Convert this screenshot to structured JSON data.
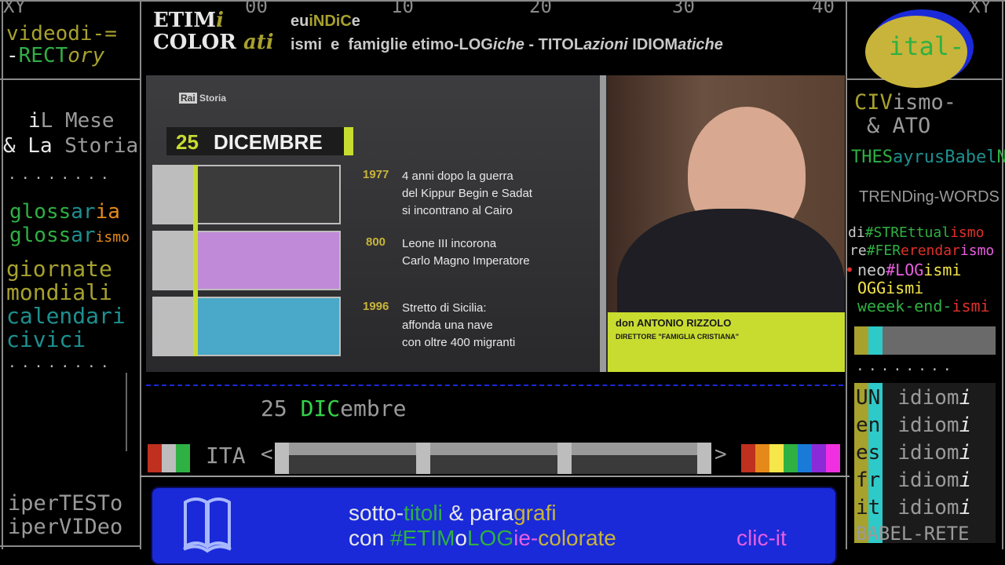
{
  "ruler": {
    "xy_left": "XY",
    "xy_right": "XY",
    "marks": [
      "00",
      "10",
      "20",
      "30",
      "40"
    ]
  },
  "logo": {
    "line1_a": "ETIM",
    "line1_b": "i",
    "line2_a": "COLOR",
    "line2_b": "ati"
  },
  "header": {
    "link1_a": "eu",
    "link1_b": "iNDiC",
    "link1_c": "e",
    "link2": [
      {
        "t": "ismi  e  famiglie etimo-LOG",
        "c": "#c9c9c9"
      },
      {
        "t": "iche",
        "c": "#c9c9c9",
        "i": true
      },
      {
        "t": " - TITOL",
        "c": "#c9c9c9"
      },
      {
        "t": "azioni",
        "c": "#c9c9c9",
        "i": true
      },
      {
        "t": " IDIOM",
        "c": "#c9c9c9"
      },
      {
        "t": "atiche",
        "c": "#c9c9c9",
        "i": true
      }
    ]
  },
  "left_nav": {
    "video_a": "videodi-=",
    "video_b": "RECT",
    "video_c": "ory",
    "mese_a": "i",
    "mese_b": "L Mese",
    "storia_a": "& La ",
    "storia_b": "Storia",
    "dots1": "........",
    "gloss1_a": "gloss",
    "gloss1_b": "ar",
    "gloss1_c": "ia",
    "gloss2_a": "gloss",
    "gloss2_b": "ar",
    "gloss2_c": "ismo",
    "giornate": "giornate",
    "mondiali": "mondiali",
    "calendari": "calendari",
    "civici": "civici",
    "dots2": "........",
    "ipertesto": "iperTESTo",
    "ipervideo": "iperVIDeo"
  },
  "badge": {
    "label": "ital-",
    "color": "#c8b43a",
    "ring": "#1a2ad8"
  },
  "right_nav": {
    "civ_a": "CIV",
    "civ_b": "ismo-",
    "ato_a": "&  ",
    "ato_b": "ATO",
    "thes": [
      {
        "t": "T",
        "c": "#2fb043"
      },
      {
        "t": "HES",
        "c": "#2fb043"
      },
      {
        "t": "ayrus",
        "c": "#1e8f8f"
      },
      {
        "t": "Babel",
        "c": "#1e8f8f"
      },
      {
        "t": "Net",
        "c": "#2fb043"
      }
    ],
    "trending": "TRENDing-WORDS",
    "hashtags": [
      {
        "parts": [
          {
            "t": "di",
            "c": "#c9c9c9"
          },
          {
            "t": "#STREttual",
            "c": "#2fb043"
          },
          {
            "t": "ismo",
            "c": "#e0302a"
          }
        ]
      },
      {
        "parts": [
          {
            "t": "re",
            "c": "#c9c9c9"
          },
          {
            "t": "#FER",
            "c": "#2fb043"
          },
          {
            "t": "erendar",
            "c": "#e0302a"
          },
          {
            "t": "ismo",
            "c": "#e85fe0"
          }
        ]
      },
      {
        "parts": [
          {
            "t": "neo",
            "c": "#c9c9c9"
          },
          {
            "t": "#LOG",
            "c": "#e85fe0"
          },
          {
            "t": "ismi",
            "c": "#f5e64a"
          }
        ]
      },
      {
        "parts": [
          {
            "t": "OGG",
            "c": "#f5e64a"
          },
          {
            "t": "ismi",
            "c": "#f5e64a"
          }
        ]
      },
      {
        "parts": [
          {
            "t": "weeek-end-",
            "c": "#2fb043"
          },
          {
            "t": "ismi",
            "c": "#e0302a"
          }
        ]
      }
    ],
    "idioms": [
      {
        "code": "UN",
        "word": "idiom",
        "suf": "i"
      },
      {
        "code": "en",
        "word": "idiom",
        "suf": "i"
      },
      {
        "code": "es",
        "word": "idiom",
        "suf": "i"
      },
      {
        "code": "fr",
        "word": "idiom",
        "suf": "i"
      },
      {
        "code": "it",
        "word": "idiom",
        "suf": "i"
      }
    ],
    "babel": "BABEL-RETE"
  },
  "video": {
    "channel": "Rai Storia",
    "date_day": "25",
    "date_month": "DICEMBRE",
    "events": [
      {
        "year": "1977",
        "text": "4 anni dopo la guerra\ndel Kippur Begin e Sadat\nsi incontrano al Cairo"
      },
      {
        "year": "800",
        "text": "Leone III incorona\nCarlo Magno Imperatore"
      },
      {
        "year": "1996",
        "text": "Stretto di Sicilia:\naffonda una nave\ncon oltre 400 migranti"
      }
    ],
    "guest_name": "don ANTONIO RIZZOLO",
    "guest_role": "DIRETTORE \"FAMIGLIA CRISTIANA\""
  },
  "caption": {
    "day": "25 ",
    "month_a": "DIC",
    "month_b": "embre"
  },
  "player": {
    "lang": "ITA",
    "prev": "<",
    "next": ">"
  },
  "subtitle_bar": {
    "line1": [
      {
        "t": "sotto-",
        "c": "#e8e8e8"
      },
      {
        "t": "titoli",
        "c": "#2fb043"
      },
      {
        "t": " & para",
        "c": "#e8e8e8"
      },
      {
        "t": "grafi",
        "c": "#c8b43a"
      }
    ],
    "line2": [
      {
        "t": "con ",
        "c": "#e8e8e8"
      },
      {
        "t": "#ETIM",
        "c": "#2fb043"
      },
      {
        "t": "o",
        "c": "#e8e8e8"
      },
      {
        "t": "LOG",
        "c": "#2fb043"
      },
      {
        "t": "ie-",
        "c": "#e85fe0"
      },
      {
        "t": "colorate",
        "c": "#c8b43a"
      }
    ],
    "cta": "clic-it"
  },
  "colors": {
    "accent_blue": "#1a2ad8",
    "guest_bar": "#c8dc30"
  }
}
